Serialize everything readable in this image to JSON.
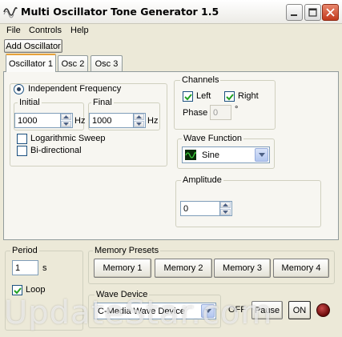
{
  "window": {
    "title": "Multi Oscillator Tone Generator 1.5"
  },
  "menu": {
    "items": [
      "File",
      "Controls",
      "Help"
    ]
  },
  "toolbar": {
    "add_oscillator": "Add Oscillator"
  },
  "tabs": [
    {
      "label": "Oscillator 1",
      "active": true
    },
    {
      "label": "Osc 2",
      "active": false
    },
    {
      "label": "Osc 3",
      "active": false
    }
  ],
  "frequency": {
    "mode_label": "Independent Frequency",
    "initial_label": "Initial",
    "final_label": "Final",
    "initial_value": "1000",
    "final_value": "1000",
    "unit": "Hz",
    "log_sweep_label": "Logarithmic Sweep",
    "log_sweep_checked": false,
    "bidirectional_label": "Bi-directional",
    "bidirectional_checked": false
  },
  "channels": {
    "label": "Channels",
    "left_label": "Left",
    "left_checked": true,
    "right_label": "Right",
    "right_checked": true,
    "phase_label": "Phase",
    "phase_value": "0",
    "phase_unit": "°"
  },
  "wave_function": {
    "label": "Wave Function",
    "selected": "Sine"
  },
  "amplitude": {
    "label": "Amplitude",
    "value": "0"
  },
  "period": {
    "label": "Period",
    "value": "1",
    "unit": "s",
    "loop_label": "Loop",
    "loop_checked": true
  },
  "memory": {
    "label": "Memory Presets",
    "buttons": [
      "Memory 1",
      "Memory 2",
      "Memory 3",
      "Memory 4"
    ]
  },
  "wave_device": {
    "label": "Wave Device",
    "selected": "C-Media Wave Device"
  },
  "transport": {
    "off_label": "OFF",
    "pause_label": "Pause",
    "on_label": "ON"
  },
  "watermark": "UpdateStar.com",
  "colors": {
    "tab_highlight": "#e7a23a",
    "close_button": "#c2391c",
    "led": "#6b0a0a"
  }
}
